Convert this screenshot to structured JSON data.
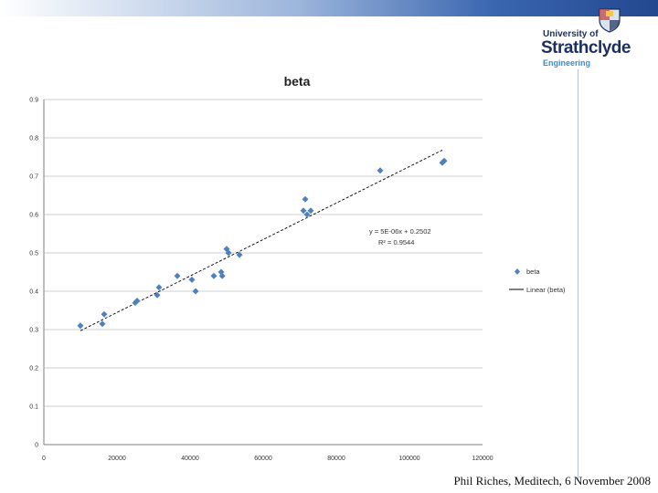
{
  "branding": {
    "line1": "University of",
    "line2": "Strathclyde",
    "line3": "Engineering"
  },
  "footer": {
    "text": "Phil Riches, Meditech, 6 November 2008"
  },
  "colors": {
    "marker": "#4f81bd",
    "trendline": "#000000",
    "gridline": "#bfbfbf",
    "logo_navy": "#1d2f5c",
    "logo_blue": "#3a8cd0"
  },
  "chart_data": {
    "type": "scatter",
    "title": "beta",
    "xlim": [
      0,
      120000
    ],
    "ylim": [
      0,
      0.9
    ],
    "x_ticks": [
      "0",
      "20000",
      "40000",
      "60000",
      "80000",
      "100000",
      "120000"
    ],
    "y_ticks": [
      "0",
      "0.1",
      "0.2",
      "0.3",
      "0.4",
      "0.5",
      "0.6",
      "0.7",
      "0.8",
      "0.9"
    ],
    "grid": true,
    "legend_position": "right",
    "series": [
      {
        "name": "beta",
        "marker": "diamond",
        "points": [
          [
            10000,
            0.31
          ],
          [
            16000,
            0.315
          ],
          [
            16500,
            0.34
          ],
          [
            25000,
            0.37
          ],
          [
            25500,
            0.375
          ],
          [
            31000,
            0.39
          ],
          [
            31500,
            0.41
          ],
          [
            36500,
            0.44
          ],
          [
            40500,
            0.43
          ],
          [
            41500,
            0.4
          ],
          [
            46500,
            0.44
          ],
          [
            48500,
            0.45
          ],
          [
            48800,
            0.44
          ],
          [
            50000,
            0.51
          ],
          [
            50500,
            0.5
          ],
          [
            53500,
            0.495
          ],
          [
            71000,
            0.61
          ],
          [
            71500,
            0.64
          ],
          [
            72000,
            0.6
          ],
          [
            73000,
            0.61
          ],
          [
            92000,
            0.715
          ],
          [
            109000,
            0.735
          ],
          [
            109500,
            0.74
          ]
        ]
      },
      {
        "name": "Linear (beta)",
        "type": "line",
        "points": [
          [
            10000,
            0.297
          ],
          [
            109000,
            0.768
          ]
        ]
      }
    ],
    "annotation": {
      "equation": "y = 5E-06x + 0.2502",
      "r_squared": "R² = 0.9544"
    }
  }
}
